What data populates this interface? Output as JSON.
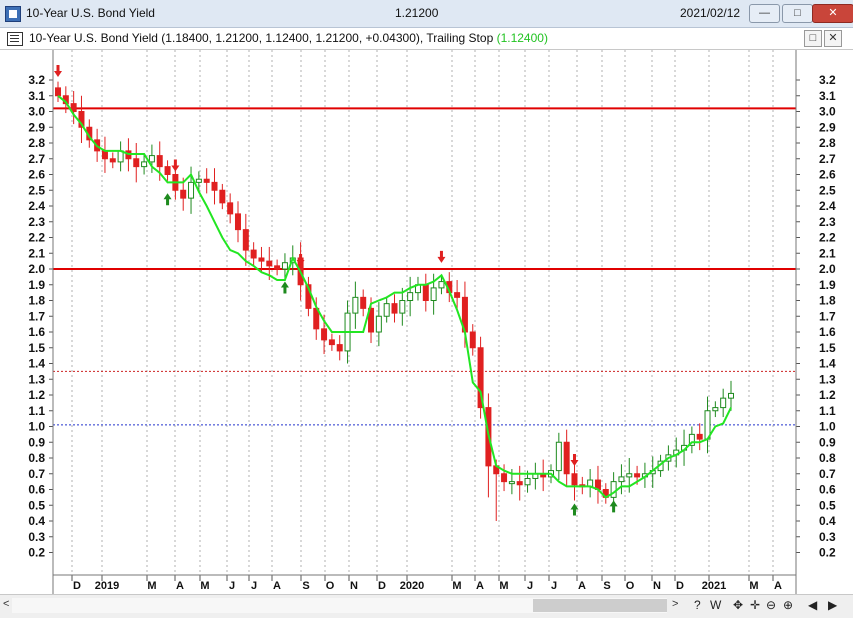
{
  "window": {
    "title": "10-Year U.S. Bond Yield",
    "last_price": "1.21200",
    "date": "2021/02/12",
    "minimize_icon": "minimize-icon",
    "maximize_icon": "maximize-icon",
    "close_icon": "close-icon"
  },
  "pane": {
    "legend_prefix": "10-Year U.S. Bond Yield (1.18400, 1.21200, 1.12400, 1.21200, +0.04300), Trailing Stop ",
    "trailing_stop_value": "(1.12400)",
    "maximize_icon": "pane-maximize-icon",
    "close_icon": "pane-close-icon"
  },
  "toolbar": {
    "items": [
      "?",
      "W",
      "✥",
      "✛",
      "⊖",
      "⊕",
      "◀",
      "▶"
    ]
  },
  "colors": {
    "up": "#1e8a1e",
    "down": "#e02020",
    "trailing_stop": "#22e622",
    "support_resistance": "#e00000",
    "dotted_red": "#cc2222",
    "dotted_blue": "#2233cc"
  },
  "chart_data": {
    "type": "candlestick",
    "title": "10-Year U.S. Bond Yield",
    "ylim": [
      0.1,
      3.35
    ],
    "y_ticks": [
      "3.2",
      "3.1",
      "3.0",
      "2.9",
      "2.8",
      "2.7",
      "2.6",
      "2.5",
      "2.4",
      "2.3",
      "2.2",
      "2.1",
      "2.0",
      "1.9",
      "1.8",
      "1.7",
      "1.6",
      "1.5",
      "1.4",
      "1.3",
      "1.2",
      "1.1",
      "1.0",
      "0.9",
      "0.8",
      "0.7",
      "0.6",
      "0.5",
      "0.4",
      "0.3",
      "0.2"
    ],
    "x_labels": [
      "D",
      "2019",
      "M",
      "A",
      "M",
      "J",
      "J",
      "A",
      "S",
      "O",
      "N",
      "D",
      "2020",
      "M",
      "A",
      "M",
      "J",
      "J",
      "A",
      "S",
      "O",
      "N",
      "D",
      "2021",
      "M",
      "A"
    ],
    "horizontal_lines": [
      {
        "y": 3.02,
        "style": "solid"
      },
      {
        "y": 2.0,
        "style": "solid"
      },
      {
        "y": 1.35,
        "style": "dotted"
      },
      {
        "y": 1.01,
        "style": "dotted"
      }
    ],
    "weekly_closes": [
      3.1,
      3.05,
      3.0,
      2.9,
      2.82,
      2.75,
      2.7,
      2.68,
      2.75,
      2.7,
      2.65,
      2.68,
      2.72,
      2.65,
      2.6,
      2.5,
      2.45,
      2.55,
      2.57,
      2.55,
      2.5,
      2.42,
      2.35,
      2.25,
      2.12,
      2.07,
      2.05,
      2.02,
      2.0,
      2.04,
      2.07,
      1.9,
      1.75,
      1.62,
      1.55,
      1.52,
      1.48,
      1.72,
      1.82,
      1.75,
      1.6,
      1.7,
      1.78,
      1.72,
      1.8,
      1.85,
      1.9,
      1.8,
      1.88,
      1.92,
      1.85,
      1.82,
      1.6,
      1.5,
      1.12,
      0.75,
      0.7,
      0.65,
      0.65,
      0.63,
      0.67,
      0.7,
      0.68,
      0.72,
      0.9,
      0.7,
      0.63,
      0.62,
      0.66,
      0.6,
      0.55,
      0.65,
      0.68,
      0.7,
      0.68,
      0.7,
      0.72,
      0.78,
      0.82,
      0.85,
      0.88,
      0.95,
      0.92,
      1.1,
      1.12,
      1.18,
      1.21
    ],
    "trailing_stop": [
      3.1,
      3.06,
      2.98,
      2.92,
      2.84,
      2.78,
      2.75,
      2.75,
      2.75,
      2.73,
      2.73,
      2.73,
      2.65,
      2.61,
      2.55,
      2.55,
      2.55,
      2.6,
      2.49,
      2.4,
      2.3,
      2.2,
      2.12,
      2.1,
      2.05,
      2.02,
      1.98,
      1.96,
      1.93,
      1.93,
      2.07,
      1.98,
      1.88,
      1.76,
      1.67,
      1.6,
      1.6,
      1.6,
      1.6,
      1.6,
      1.78,
      1.8,
      1.82,
      1.85,
      1.85,
      1.88,
      1.9,
      1.9,
      1.92,
      1.96,
      1.86,
      1.74,
      1.6,
      1.28,
      1.22,
      0.95,
      0.75,
      0.72,
      0.7,
      0.7,
      0.7,
      0.7,
      0.7,
      0.7,
      0.65,
      0.62,
      0.62,
      0.62,
      0.62,
      0.6,
      0.55,
      0.58,
      0.62,
      0.62,
      0.65,
      0.68,
      0.72,
      0.76,
      0.8,
      0.82,
      0.85,
      0.9,
      0.9,
      0.92,
      1.0,
      1.02,
      1.12
    ],
    "down_arrows_week_index": [
      0,
      15,
      31,
      49,
      66
    ],
    "up_arrows_week_index": [
      14,
      29,
      66,
      71
    ]
  }
}
